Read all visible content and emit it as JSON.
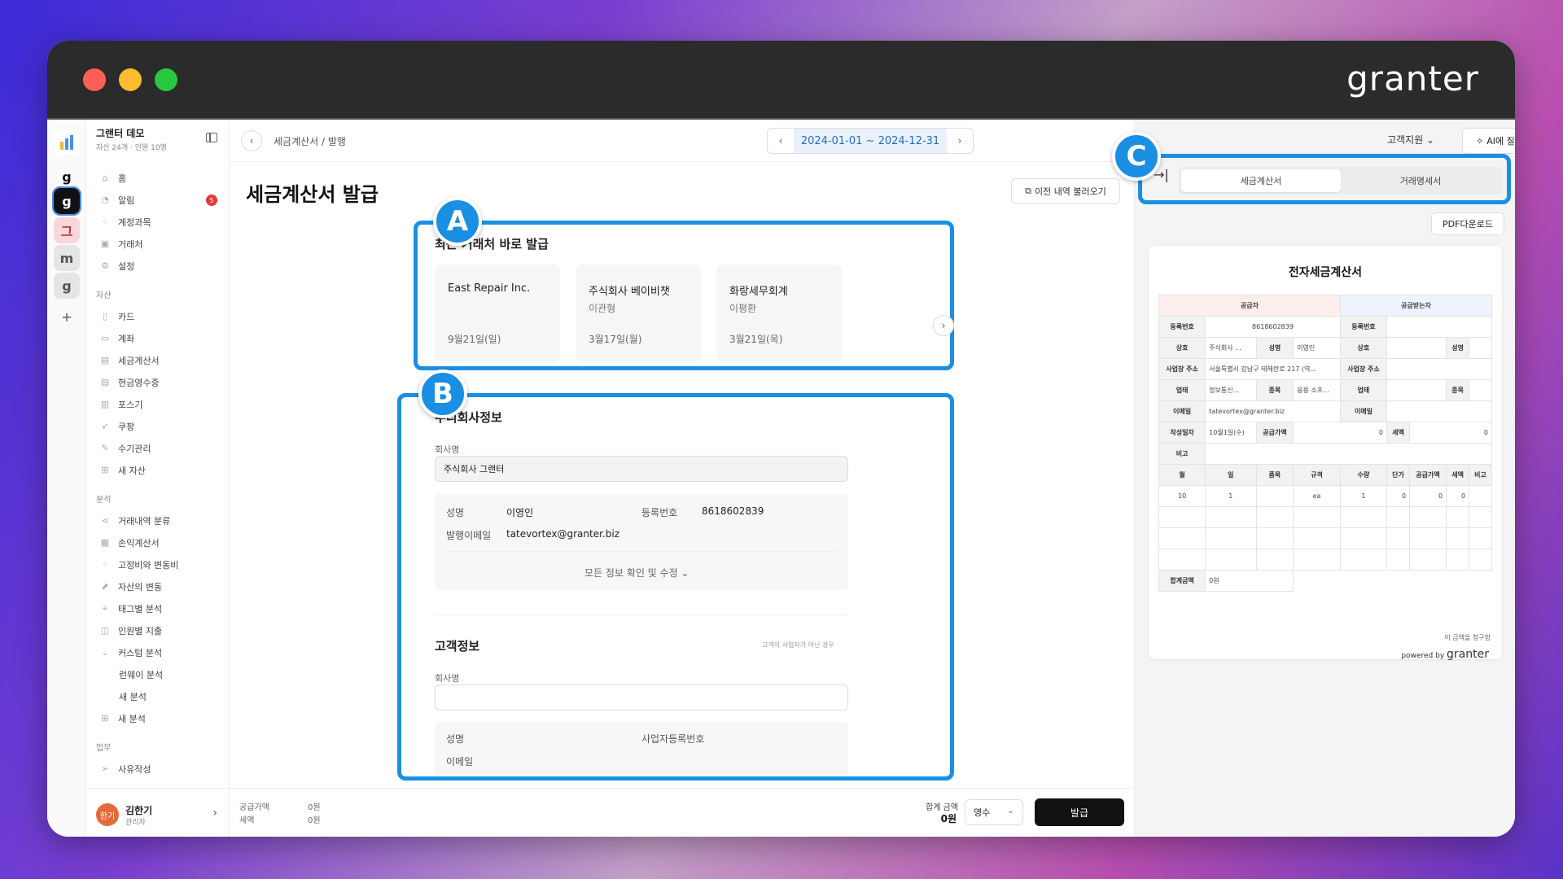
{
  "window": {
    "brand": "granter"
  },
  "rail": {
    "items": [
      "g",
      "g",
      "그",
      "m",
      "g",
      "+"
    ]
  },
  "sidebar": {
    "org_name": "그랜터 데모",
    "org_sub": "자산 24개 · 인원 10명",
    "items": [
      {
        "label": "홈"
      },
      {
        "label": "알림",
        "badge": "5"
      },
      {
        "label": "계정과목"
      },
      {
        "label": "거래처"
      },
      {
        "label": "설정"
      }
    ],
    "asset_section": "자산",
    "asset_items": [
      {
        "label": "카드"
      },
      {
        "label": "계좌"
      },
      {
        "label": "세금계산서"
      },
      {
        "label": "현금영수증"
      },
      {
        "label": "포스기"
      },
      {
        "label": "쿠팡"
      },
      {
        "label": "수기관리"
      },
      {
        "label": "새 자산"
      }
    ],
    "analysis_section": "분석",
    "analysis_items": [
      {
        "label": "거래내역 분류"
      },
      {
        "label": "손익계산서"
      },
      {
        "label": "고정비와 변동비"
      },
      {
        "label": "자산의 변동"
      },
      {
        "label": "태그별 분석"
      },
      {
        "label": "인원별 지출"
      },
      {
        "label": "커스텀 분석"
      }
    ],
    "custom_items": [
      {
        "label": "런웨이 분석"
      },
      {
        "label": "새 분석"
      }
    ],
    "new_analysis": "새 분석",
    "work_section": "업무",
    "work_items": [
      {
        "label": "사유작성"
      }
    ],
    "user": {
      "avatar": "한기",
      "name": "김한기",
      "role": "관리자"
    }
  },
  "topbar": {
    "breadcrumb": "세금계산서  /  발행",
    "date_range": "2024-01-01 ~ 2024-12-31",
    "support": "고객지원",
    "ask_ai": "AI에 질문"
  },
  "page": {
    "title": "세금계산서 발급",
    "load_prev": "이전 내역 불러오기"
  },
  "recent": {
    "title": "최근 거래처 바로 발급",
    "cards": [
      {
        "name": "East Repair Inc.",
        "person": "",
        "date": "9월21일(일)"
      },
      {
        "name": "주식회사 베이비챗",
        "person": "이관형",
        "date": "3월17일(월)"
      },
      {
        "name": "화랑세무회계",
        "person": "이평환",
        "date": "3월21일(목)"
      }
    ]
  },
  "company": {
    "title": "우리회사정보",
    "name_label": "회사명",
    "name_value": "주식회사 그랜터",
    "rep_label": "성명",
    "rep_value": "이영인",
    "reg_label": "등록번호",
    "reg_value": "8618602839",
    "email_label": "발행이메일",
    "email_value": "tatevortex@granter.biz",
    "all_info": "모든 정보 확인 및 수정 ⌄"
  },
  "customer": {
    "title": "고객정보",
    "note": "고객이 사업자가 아닌 경우",
    "name_label": "회사명",
    "name_value": "",
    "rep_label": "성명",
    "reg_label": "사업자등록번호",
    "email_label": "이메일"
  },
  "bottom": {
    "supply_label": "공급가액",
    "supply_value": "0원",
    "tax_label": "세액",
    "tax_value": "0원",
    "total_label": "합계 금액",
    "total_value": "0원",
    "receipt": "영수",
    "issue": "발급"
  },
  "panel": {
    "tab_tax": "세금계산서",
    "tab_stmt": "거래명세서",
    "pdf": "PDF다운로드"
  },
  "invoice": {
    "title": "전자세금계산서",
    "supplier": "공급자",
    "receiver": "공급받는자",
    "reg_label": "등록번호",
    "reg_value": "8618602839",
    "biz_label": "상호",
    "biz_value": "주식회사 ...",
    "rep_label": "성명",
    "rep_value": "이영인",
    "addr_label": "사업장 주소",
    "addr_value": "서울특별시 강남구 테헤란로 217 (역...",
    "type_label": "업태",
    "type_value": "정보통신...",
    "item_label": "종목",
    "item_value": "응용 소프...",
    "email_label": "이메일",
    "email_value": "tatevortex@granter.biz",
    "date_label": "작성일자",
    "date_value": "10월1일(수)",
    "supply_label": "공급가액",
    "supply_value": "0",
    "tax_label": "세액",
    "tax_value": "0",
    "memo_label": "비고",
    "cols": [
      "월",
      "일",
      "품목",
      "규격",
      "수량",
      "단가",
      "공급가액",
      "세액",
      "비고"
    ],
    "row": [
      "10",
      "1",
      "",
      "ea",
      "1",
      "0",
      "0",
      "0",
      ""
    ],
    "total_label": "합계금액",
    "total_value": "0원",
    "note": "이 금액을 청구함",
    "powered": "powered by",
    "powered_brand": "granter"
  },
  "markers": {
    "a": "A",
    "b": "B",
    "c": "C"
  },
  "colors": {
    "highlight": "#1a8fe3",
    "issue_button": "#111111",
    "date_accent": "#2b6cb8"
  }
}
